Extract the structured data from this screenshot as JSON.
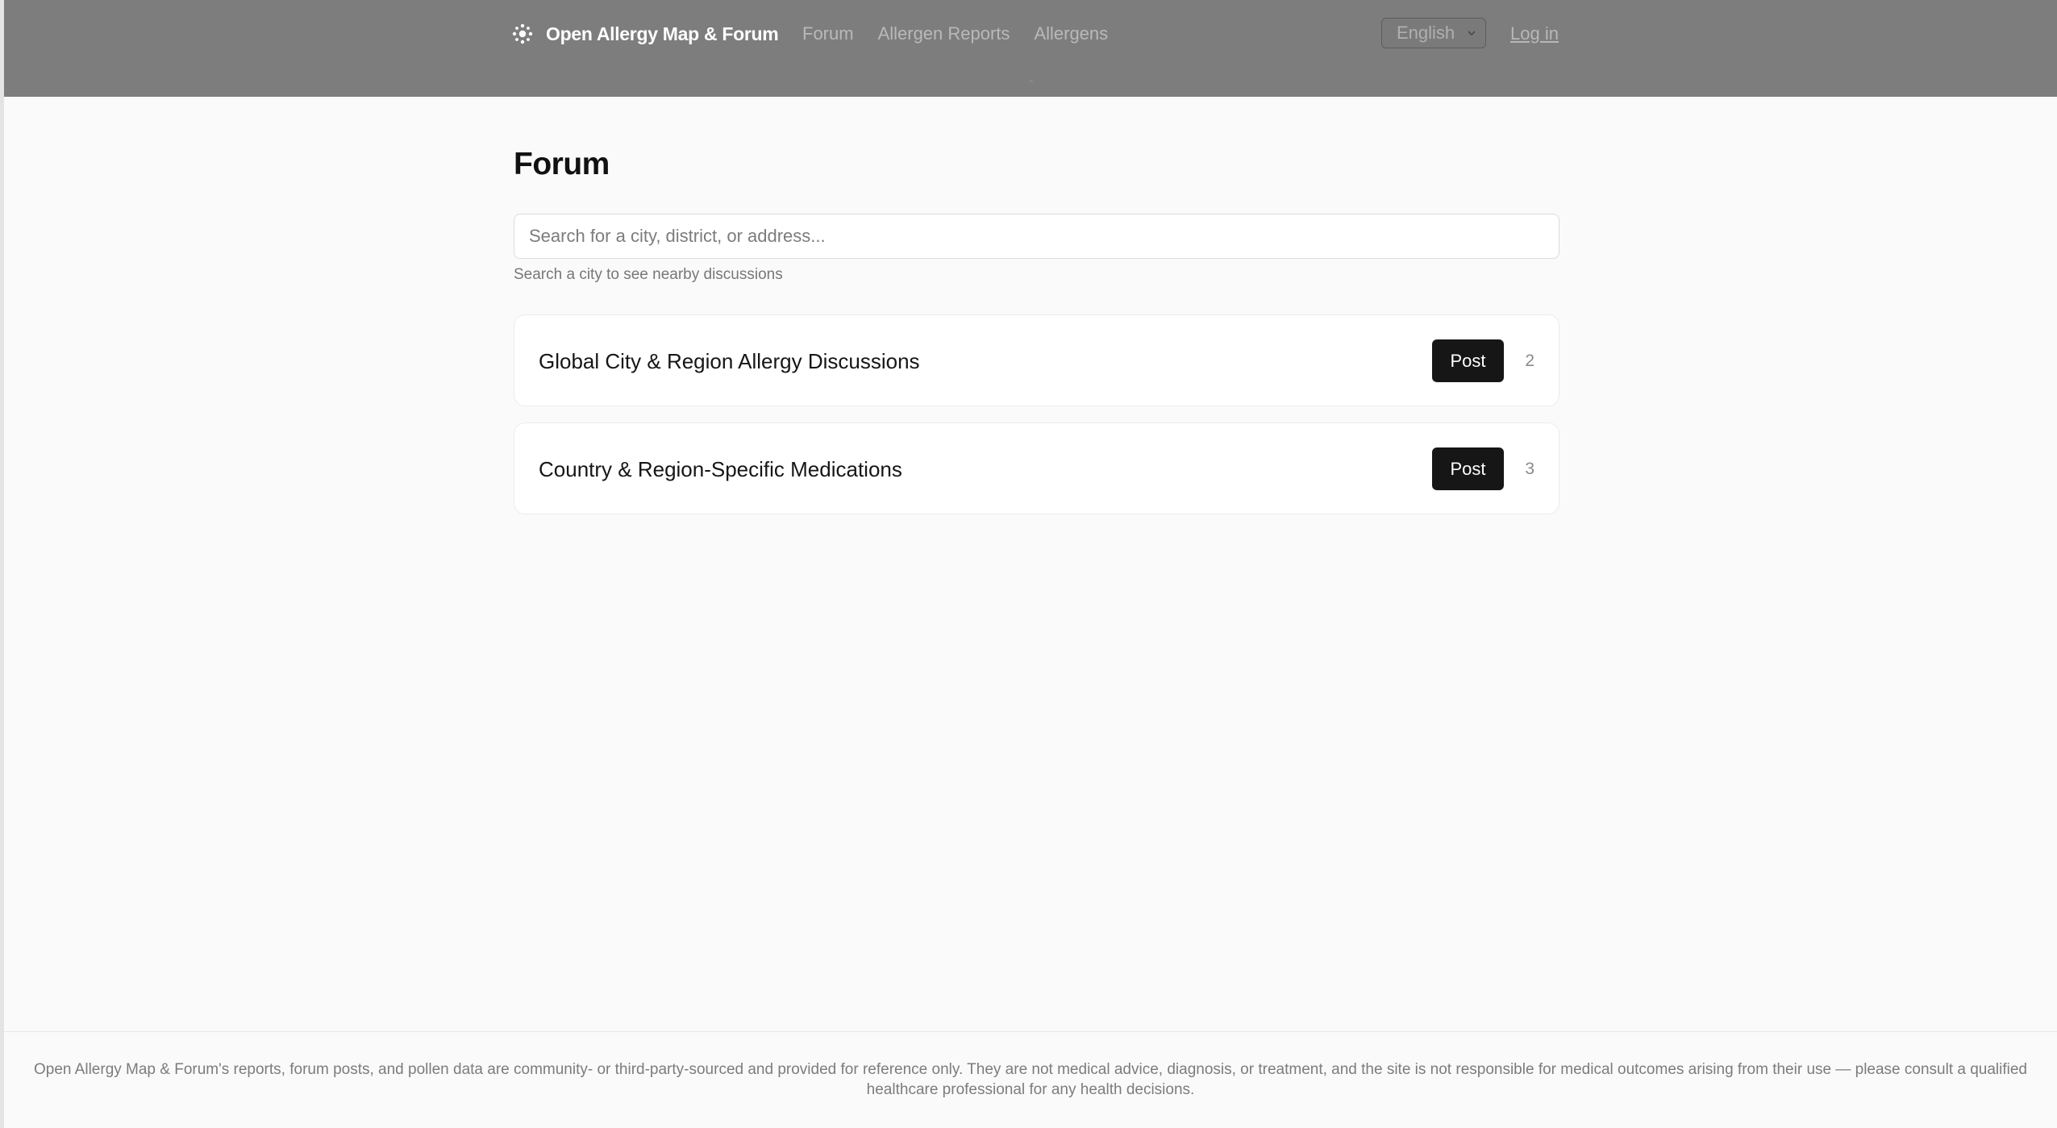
{
  "header": {
    "brand_name": "Open Allergy Map & Forum",
    "brand_icon": "pollen-icon",
    "nav": {
      "forum": "Forum",
      "allergen_reports": "Allergen Reports",
      "allergens": "Allergens"
    },
    "language": "English",
    "login": "Log in"
  },
  "main": {
    "title": "Forum",
    "search": {
      "placeholder": "Search for a city, district, or address...",
      "value": "",
      "hint": "Search a city to see nearby discussions"
    },
    "categories": [
      {
        "title": "Global City & Region Allergy Discussions",
        "post_label": "Post",
        "count": "2"
      },
      {
        "title": "Country & Region-Specific Medications",
        "post_label": "Post",
        "count": "3"
      }
    ]
  },
  "footer": {
    "disclaimer": "Open Allergy Map & Forum's reports, forum posts, and pollen data are community- or third-party-sourced and provided for reference only. They are not medical advice, diagnosis, or treatment, and the site is not responsible for medical outcomes arising from their use — please consult a qualified healthcare professional for any health decisions."
  },
  "colors": {
    "header_bg": "#7d7d7d",
    "page_bg": "#fafafa",
    "button_bg": "#161616"
  }
}
